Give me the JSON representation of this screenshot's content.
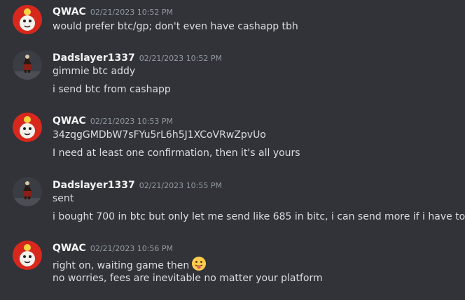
{
  "messages": [
    {
      "username": "QWAC",
      "timestamp": "02/21/2023 10:52 PM",
      "avatar_icon": "qwac-avatar-icon",
      "lines": [
        "would prefer btc/gp; don't even have cashapp tbh"
      ]
    },
    {
      "username": "Dadslayer1337",
      "timestamp": "02/21/2023 10:52 PM",
      "avatar_icon": "dadslayer-avatar-icon",
      "lines": [
        "gimmie btc addy",
        "i send btc from cashapp"
      ]
    },
    {
      "username": "QWAC",
      "timestamp": "02/21/2023 10:53 PM",
      "avatar_icon": "qwac-avatar-icon",
      "lines": [
        "34zqgGMDbW7sFYu5rL6h5J1XCoVRwZpvUo",
        "I need at least one confirmation, then it's all yours"
      ]
    },
    {
      "username": "Dadslayer1337",
      "timestamp": "02/21/2023 10:55 PM",
      "avatar_icon": "dadslayer-avatar-icon",
      "lines": [
        "sent",
        "i bought 700 in btc but only let me send like 685 in bitc, i can send more if i have to"
      ]
    },
    {
      "username": "QWAC",
      "timestamp": "02/21/2023 10:56 PM",
      "avatar_icon": "qwac-avatar-icon",
      "lines": [
        "right on, waiting game then",
        "no worries, fees are inevitable no matter your platform"
      ],
      "emoji": "tongue-out-emoji-icon"
    }
  ],
  "colors": {
    "background": "#313338",
    "username": "#f2f3f5",
    "timestamp": "#949ba4",
    "text": "#dbdee1",
    "qwac_avatar_bg": "#d8281d"
  }
}
